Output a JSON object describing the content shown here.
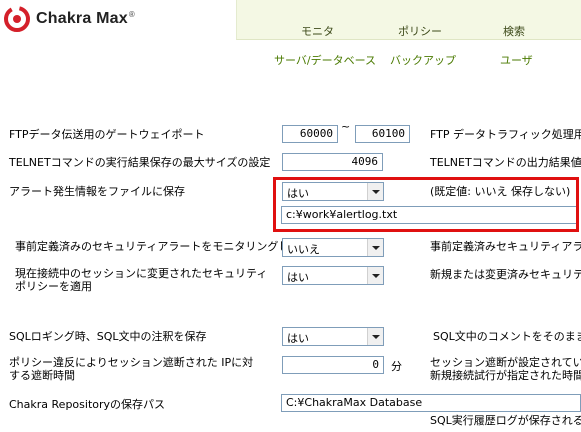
{
  "header": {
    "logo_text": "Chakra Max",
    "logo_reg": "®",
    "tabs": [
      "モニタ",
      "ポリシー",
      "検索"
    ],
    "subtabs": [
      "サーバ/データベース",
      "バックアップ",
      "ユーザ"
    ]
  },
  "rows": {
    "ftp_port": {
      "label": "FTPデータ伝送用のゲートウェイポート",
      "from": "60000",
      "sep": "~",
      "to": "60100",
      "desc": "FTP データトラフィック処理用とし"
    },
    "telnet_size": {
      "label": "TELNETコマンドの実行結果保存の最大サイズの設定",
      "value": "4096",
      "desc": "TELNETコマンドの出力結果値("
    },
    "alert_file": {
      "label": "アラート発生情報をファイルに保存",
      "select": "はい",
      "desc": "(既定値: いいえ 保存しない)",
      "path": "c:¥work¥alertlog.txt"
    },
    "security_alert": {
      "label": "事前定義済みのセキュリティアラートをモニタリングしない",
      "select": "いいえ",
      "desc": "事前定義済みセキュリティアラー"
    },
    "session_policy": {
      "label": "現在接続中のセッションに変更されたセキュリティポリシーを適用",
      "select": "はい",
      "desc": "新規または変更済みセキュリティ"
    },
    "sql_logging": {
      "label": "SQLロギング時、SQL文中の注釈を保存",
      "select": "はい",
      "desc": "SQL文中のコメントをそのままCh"
    },
    "session_block": {
      "label": "ポリシー違反によりセッション遮断された IPに対する遮断時間",
      "value": "0",
      "unit": "分",
      "desc_line1": "セッション遮断が設定されている",
      "desc_line2": "新規接続試行が指定された時間"
    },
    "repository": {
      "label": "Chakra Repositoryの保存パス",
      "path": "C:¥ChakraMax Database",
      "desc": "SQL実行履歴ログが保存される"
    }
  }
}
